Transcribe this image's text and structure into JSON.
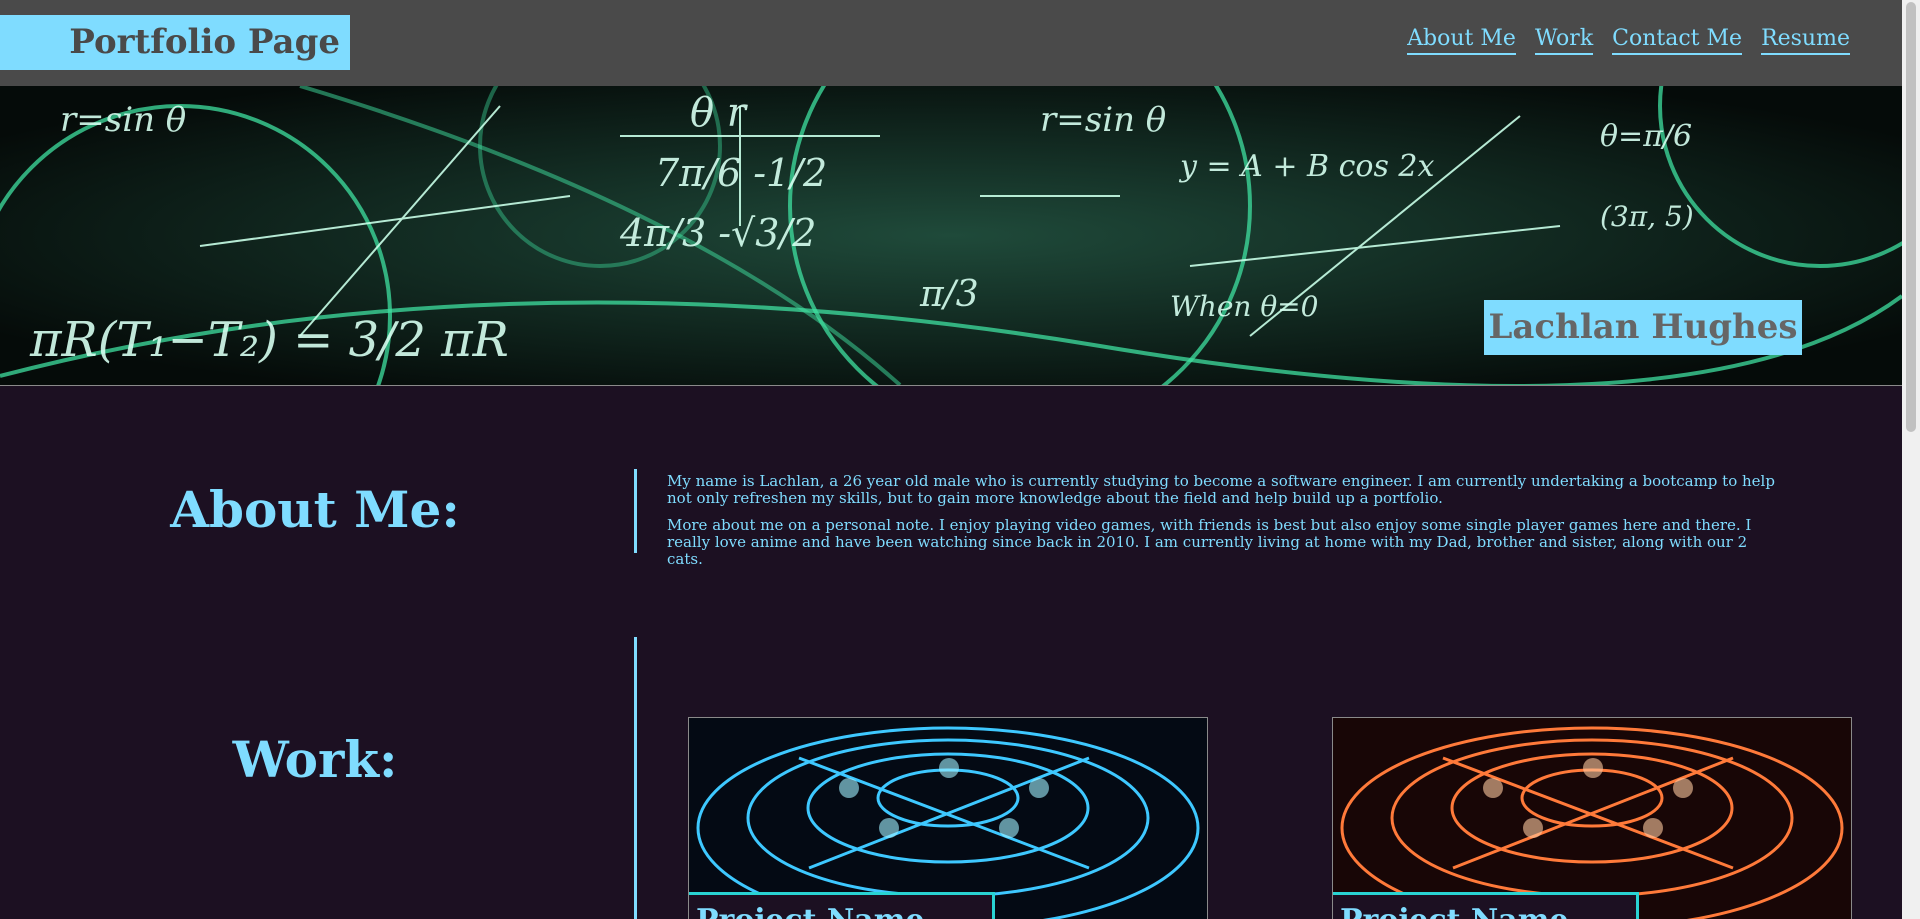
{
  "header": {
    "brand": "Portfolio Page",
    "nav": [
      "About Me",
      "Work",
      "Contact Me",
      "Resume"
    ]
  },
  "hero": {
    "name": "Lachlan Hughes"
  },
  "about": {
    "title": "About Me:",
    "paragraphs": [
      "My name is Lachlan, a 26 year old male who is currently studying to become a software engineer. I am currently undertaking a bootcamp to help not only refreshen my skills, but to gain more knowledge about the field and help build up a portfolio.",
      "More about me on a personal note. I enjoy playing video games, with friends is best but also enjoy some single player games here and there. I really love anime and have been watching since back in 2010. I am currently living at home with my Dad, brother and sister, along with our 2 cats."
    ]
  },
  "work": {
    "title": "Work:",
    "projects": [
      {
        "label": "Project Name",
        "accent": "#3ec8ff"
      },
      {
        "label": "Project Name",
        "accent": "#ff7a3a"
      }
    ]
  },
  "colors": {
    "accent": "#7fdcff",
    "background": "#1c1022",
    "header": "#4a4a4a",
    "project_border": "#29d3d3"
  }
}
